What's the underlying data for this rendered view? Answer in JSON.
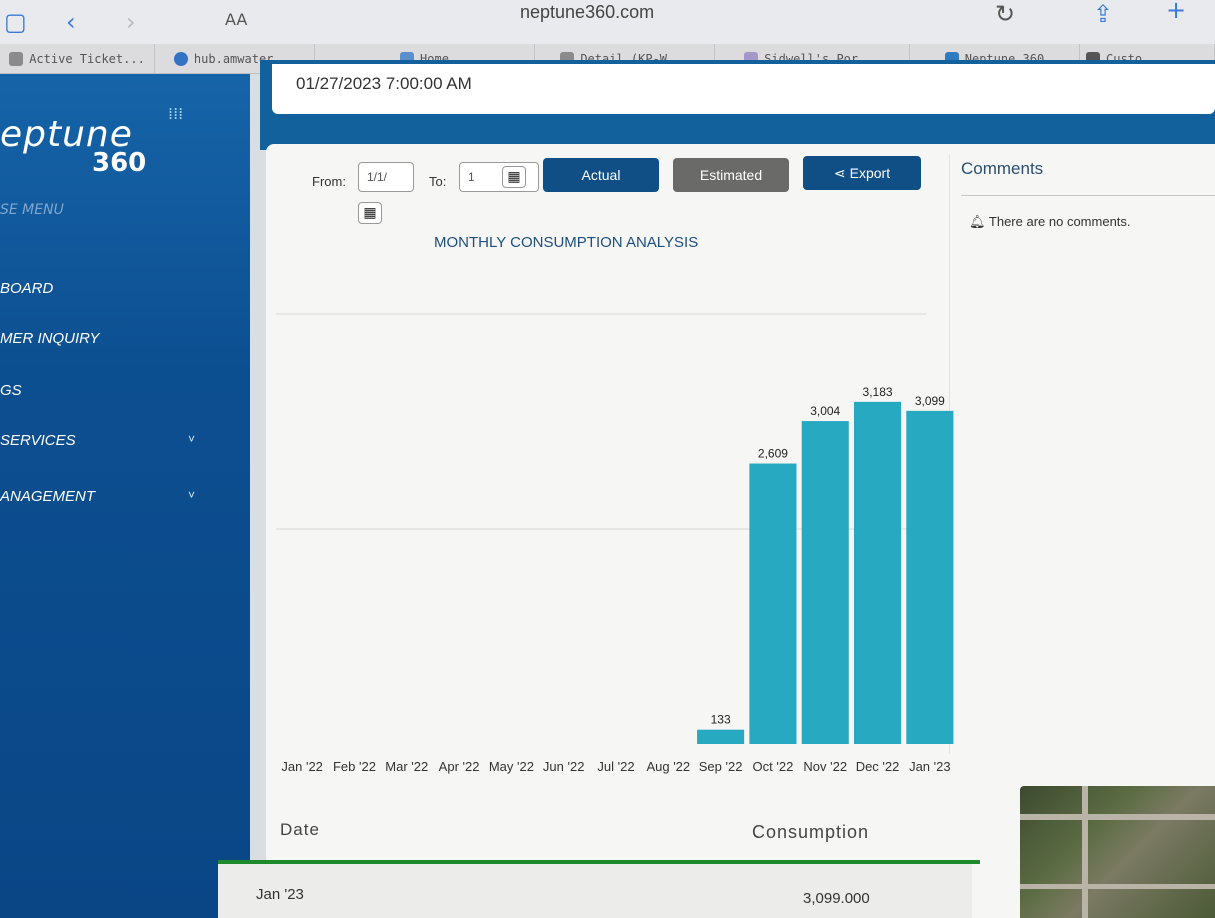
{
  "browser": {
    "url": "neptune360.com",
    "text_size_label": "AA",
    "tabs": [
      {
        "label": "Active Ticket..."
      },
      {
        "label": "hub.amwater..."
      },
      {
        "label": "Home"
      },
      {
        "label": "Detail (KP-W..."
      },
      {
        "label": "Sidwell's Por..."
      },
      {
        "label": "Neptune 360"
      },
      {
        "label": "Custo"
      }
    ]
  },
  "sidebar": {
    "logo_top": "eptune",
    "logo_bottom": "360",
    "close_menu": "SE MENU",
    "items": [
      {
        "label": "BOARD"
      },
      {
        "label": "MER INQUIRY"
      },
      {
        "label": "GS"
      },
      {
        "label": "SERVICES",
        "chevron": "˅"
      },
      {
        "label": "ANAGEMENT",
        "chevron": "˅"
      }
    ]
  },
  "summary": {
    "date": "01/27/2023 7:00:00 AM"
  },
  "controls": {
    "from_label": "From:",
    "from_value": "1/1/",
    "to_label": "To:",
    "to_value": "1",
    "actual_label": "Actual",
    "estimated_label": "Estimated",
    "export_label": "Export"
  },
  "chart": {
    "title": "MONTHLY CONSUMPTION ANALYSIS",
    "bar_color": "#26a9c1"
  },
  "chart_data": {
    "type": "bar",
    "categories": [
      "Jan '22",
      "Feb '22",
      "Mar '22",
      "Apr '22",
      "May '22",
      "Jun '22",
      "Jul '22",
      "Aug '22",
      "Sep '22",
      "Oct '22",
      "Nov '22",
      "Dec '22",
      "Jan '23"
    ],
    "values": [
      0,
      0,
      0,
      0,
      0,
      0,
      0,
      0,
      133,
      2609,
      3004,
      3183,
      3099
    ],
    "data_labels": [
      "",
      "",
      "",
      "",
      "",
      "",
      "",
      "",
      "133",
      "2,609",
      "3,004",
      "3,183",
      "3,099"
    ],
    "title": "MONTHLY CONSUMPTION ANALYSIS",
    "xlabel": "",
    "ylabel": "",
    "ylim": [
      0,
      4000
    ],
    "grid": true
  },
  "comments": {
    "title": "Comments",
    "empty_text": "There are no comments."
  },
  "table": {
    "headers": {
      "date": "Date",
      "consumption": "Consumption"
    },
    "rows": [
      {
        "date": "Jan '23",
        "consumption": "3,099.000"
      }
    ]
  }
}
